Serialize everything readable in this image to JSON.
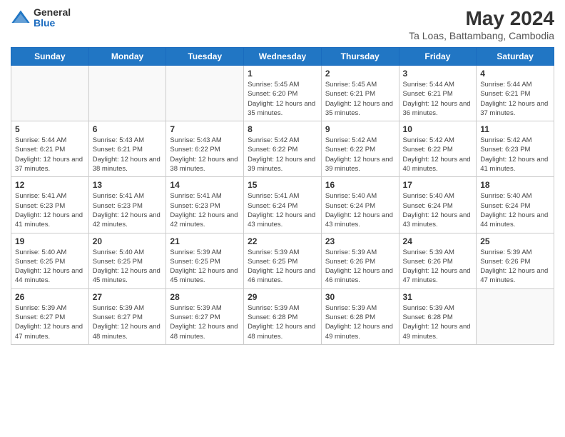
{
  "header": {
    "logo_general": "General",
    "logo_blue": "Blue",
    "title": "May 2024",
    "subtitle": "Ta Loas, Battambang, Cambodia"
  },
  "days_of_week": [
    "Sunday",
    "Monday",
    "Tuesday",
    "Wednesday",
    "Thursday",
    "Friday",
    "Saturday"
  ],
  "weeks": [
    [
      {
        "day": "",
        "info": ""
      },
      {
        "day": "",
        "info": ""
      },
      {
        "day": "",
        "info": ""
      },
      {
        "day": "1",
        "info": "Sunrise: 5:45 AM\nSunset: 6:20 PM\nDaylight: 12 hours\nand 35 minutes."
      },
      {
        "day": "2",
        "info": "Sunrise: 5:45 AM\nSunset: 6:21 PM\nDaylight: 12 hours\nand 35 minutes."
      },
      {
        "day": "3",
        "info": "Sunrise: 5:44 AM\nSunset: 6:21 PM\nDaylight: 12 hours\nand 36 minutes."
      },
      {
        "day": "4",
        "info": "Sunrise: 5:44 AM\nSunset: 6:21 PM\nDaylight: 12 hours\nand 37 minutes."
      }
    ],
    [
      {
        "day": "5",
        "info": "Sunrise: 5:44 AM\nSunset: 6:21 PM\nDaylight: 12 hours\nand 37 minutes."
      },
      {
        "day": "6",
        "info": "Sunrise: 5:43 AM\nSunset: 6:21 PM\nDaylight: 12 hours\nand 38 minutes."
      },
      {
        "day": "7",
        "info": "Sunrise: 5:43 AM\nSunset: 6:22 PM\nDaylight: 12 hours\nand 38 minutes."
      },
      {
        "day": "8",
        "info": "Sunrise: 5:42 AM\nSunset: 6:22 PM\nDaylight: 12 hours\nand 39 minutes."
      },
      {
        "day": "9",
        "info": "Sunrise: 5:42 AM\nSunset: 6:22 PM\nDaylight: 12 hours\nand 39 minutes."
      },
      {
        "day": "10",
        "info": "Sunrise: 5:42 AM\nSunset: 6:22 PM\nDaylight: 12 hours\nand 40 minutes."
      },
      {
        "day": "11",
        "info": "Sunrise: 5:42 AM\nSunset: 6:23 PM\nDaylight: 12 hours\nand 41 minutes."
      }
    ],
    [
      {
        "day": "12",
        "info": "Sunrise: 5:41 AM\nSunset: 6:23 PM\nDaylight: 12 hours\nand 41 minutes."
      },
      {
        "day": "13",
        "info": "Sunrise: 5:41 AM\nSunset: 6:23 PM\nDaylight: 12 hours\nand 42 minutes."
      },
      {
        "day": "14",
        "info": "Sunrise: 5:41 AM\nSunset: 6:23 PM\nDaylight: 12 hours\nand 42 minutes."
      },
      {
        "day": "15",
        "info": "Sunrise: 5:41 AM\nSunset: 6:24 PM\nDaylight: 12 hours\nand 43 minutes."
      },
      {
        "day": "16",
        "info": "Sunrise: 5:40 AM\nSunset: 6:24 PM\nDaylight: 12 hours\nand 43 minutes."
      },
      {
        "day": "17",
        "info": "Sunrise: 5:40 AM\nSunset: 6:24 PM\nDaylight: 12 hours\nand 43 minutes."
      },
      {
        "day": "18",
        "info": "Sunrise: 5:40 AM\nSunset: 6:24 PM\nDaylight: 12 hours\nand 44 minutes."
      }
    ],
    [
      {
        "day": "19",
        "info": "Sunrise: 5:40 AM\nSunset: 6:25 PM\nDaylight: 12 hours\nand 44 minutes."
      },
      {
        "day": "20",
        "info": "Sunrise: 5:40 AM\nSunset: 6:25 PM\nDaylight: 12 hours\nand 45 minutes."
      },
      {
        "day": "21",
        "info": "Sunrise: 5:39 AM\nSunset: 6:25 PM\nDaylight: 12 hours\nand 45 minutes."
      },
      {
        "day": "22",
        "info": "Sunrise: 5:39 AM\nSunset: 6:25 PM\nDaylight: 12 hours\nand 46 minutes."
      },
      {
        "day": "23",
        "info": "Sunrise: 5:39 AM\nSunset: 6:26 PM\nDaylight: 12 hours\nand 46 minutes."
      },
      {
        "day": "24",
        "info": "Sunrise: 5:39 AM\nSunset: 6:26 PM\nDaylight: 12 hours\nand 47 minutes."
      },
      {
        "day": "25",
        "info": "Sunrise: 5:39 AM\nSunset: 6:26 PM\nDaylight: 12 hours\nand 47 minutes."
      }
    ],
    [
      {
        "day": "26",
        "info": "Sunrise: 5:39 AM\nSunset: 6:27 PM\nDaylight: 12 hours\nand 47 minutes."
      },
      {
        "day": "27",
        "info": "Sunrise: 5:39 AM\nSunset: 6:27 PM\nDaylight: 12 hours\nand 48 minutes."
      },
      {
        "day": "28",
        "info": "Sunrise: 5:39 AM\nSunset: 6:27 PM\nDaylight: 12 hours\nand 48 minutes."
      },
      {
        "day": "29",
        "info": "Sunrise: 5:39 AM\nSunset: 6:28 PM\nDaylight: 12 hours\nand 48 minutes."
      },
      {
        "day": "30",
        "info": "Sunrise: 5:39 AM\nSunset: 6:28 PM\nDaylight: 12 hours\nand 49 minutes."
      },
      {
        "day": "31",
        "info": "Sunrise: 5:39 AM\nSunset: 6:28 PM\nDaylight: 12 hours\nand 49 minutes."
      },
      {
        "day": "",
        "info": ""
      }
    ]
  ]
}
